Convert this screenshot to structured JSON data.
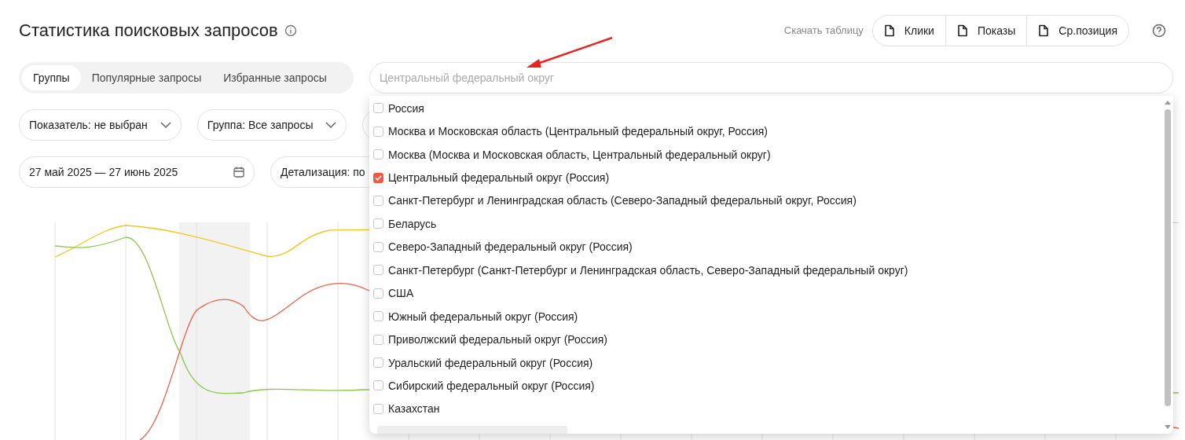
{
  "title": "Статистика поисковых запросов",
  "download": {
    "label": "Скачать таблицу",
    "buttons": [
      "Клики",
      "Показы",
      "Ср.позиция"
    ]
  },
  "tabs": [
    {
      "label": "Группы",
      "selected": true
    },
    {
      "label": "Популярные запросы",
      "selected": false
    },
    {
      "label": "Избранные запросы",
      "selected": false
    }
  ],
  "region_search": {
    "placeholder": "Центральный федеральный округ"
  },
  "filters": [
    "Показатель: не выбран",
    "Группа: Все запросы"
  ],
  "date_range": "27 май 2025 — 27 июнь 2025",
  "detail_select": "Детализация: по",
  "region_options": [
    {
      "label": "Россия",
      "checked": false
    },
    {
      "label": "Москва и Московская область (Центральный федеральный округ, Россия)",
      "checked": false
    },
    {
      "label": "Москва (Москва и Московская область, Центральный федеральный округ)",
      "checked": false
    },
    {
      "label": "Центральный федеральный округ (Россия)",
      "checked": true
    },
    {
      "label": "Санкт-Петербург и Ленинградская область (Северо-Западный федеральный округ, Россия)",
      "checked": false
    },
    {
      "label": "Беларусь",
      "checked": false
    },
    {
      "label": "Северо-Западный федеральный округ (Россия)",
      "checked": false
    },
    {
      "label": "Санкт-Петербург (Санкт-Петербург и Ленинградская область, Северо-Западный федеральный округ)",
      "checked": false
    },
    {
      "label": "США",
      "checked": false
    },
    {
      "label": "Южный федеральный округ (Россия)",
      "checked": false
    },
    {
      "label": "Приволжский федеральный округ (Россия)",
      "checked": false
    },
    {
      "label": "Уральский федеральный округ (Россия)",
      "checked": false
    },
    {
      "label": "Сибирский федеральный округ (Россия)",
      "checked": false
    },
    {
      "label": "Казахстан",
      "checked": false
    }
  ]
}
